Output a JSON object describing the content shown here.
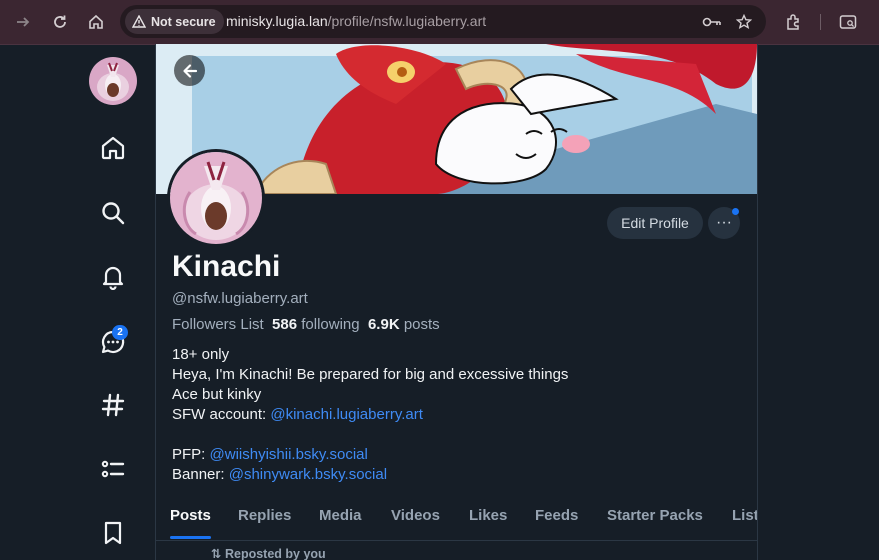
{
  "browser": {
    "security_label": "Not secure",
    "url_host": "minisky.lugia.lan",
    "url_path": "/profile/nsfw.lugiaberry.art"
  },
  "nav": {
    "notification_badge": "2"
  },
  "profile": {
    "display_name": "Kinachi",
    "handle": "@nsfw.lugiaberry.art",
    "followers_label": "Followers List",
    "following_count": "586",
    "following_label": "following",
    "posts_count": "6.9K",
    "posts_label": "posts",
    "edit_button": "Edit Profile",
    "more_button": "···"
  },
  "bio": {
    "line1": "18+ only",
    "line2": "Heya, I'm Kinachi! Be prepared for big and excessive things",
    "line3": "Ace but kinky",
    "sfw_prefix": "SFW account: ",
    "sfw_link": "@kinachi.lugiaberry.art",
    "pfp_prefix": "PFP: ",
    "pfp_link": "@wiishyishii.bsky.social",
    "banner_prefix": "Banner: ",
    "banner_link": "@shinywark.bsky.social"
  },
  "tabs": [
    "Posts",
    "Replies",
    "Media",
    "Videos",
    "Likes",
    "Feeds",
    "Starter Packs",
    "List"
  ],
  "feed": {
    "repost_label": "Reposted by you"
  },
  "colors": {
    "accent": "#1a73f2",
    "link": "#3f8bf5",
    "background": "#161e27",
    "toolbar": "#3b2631"
  }
}
